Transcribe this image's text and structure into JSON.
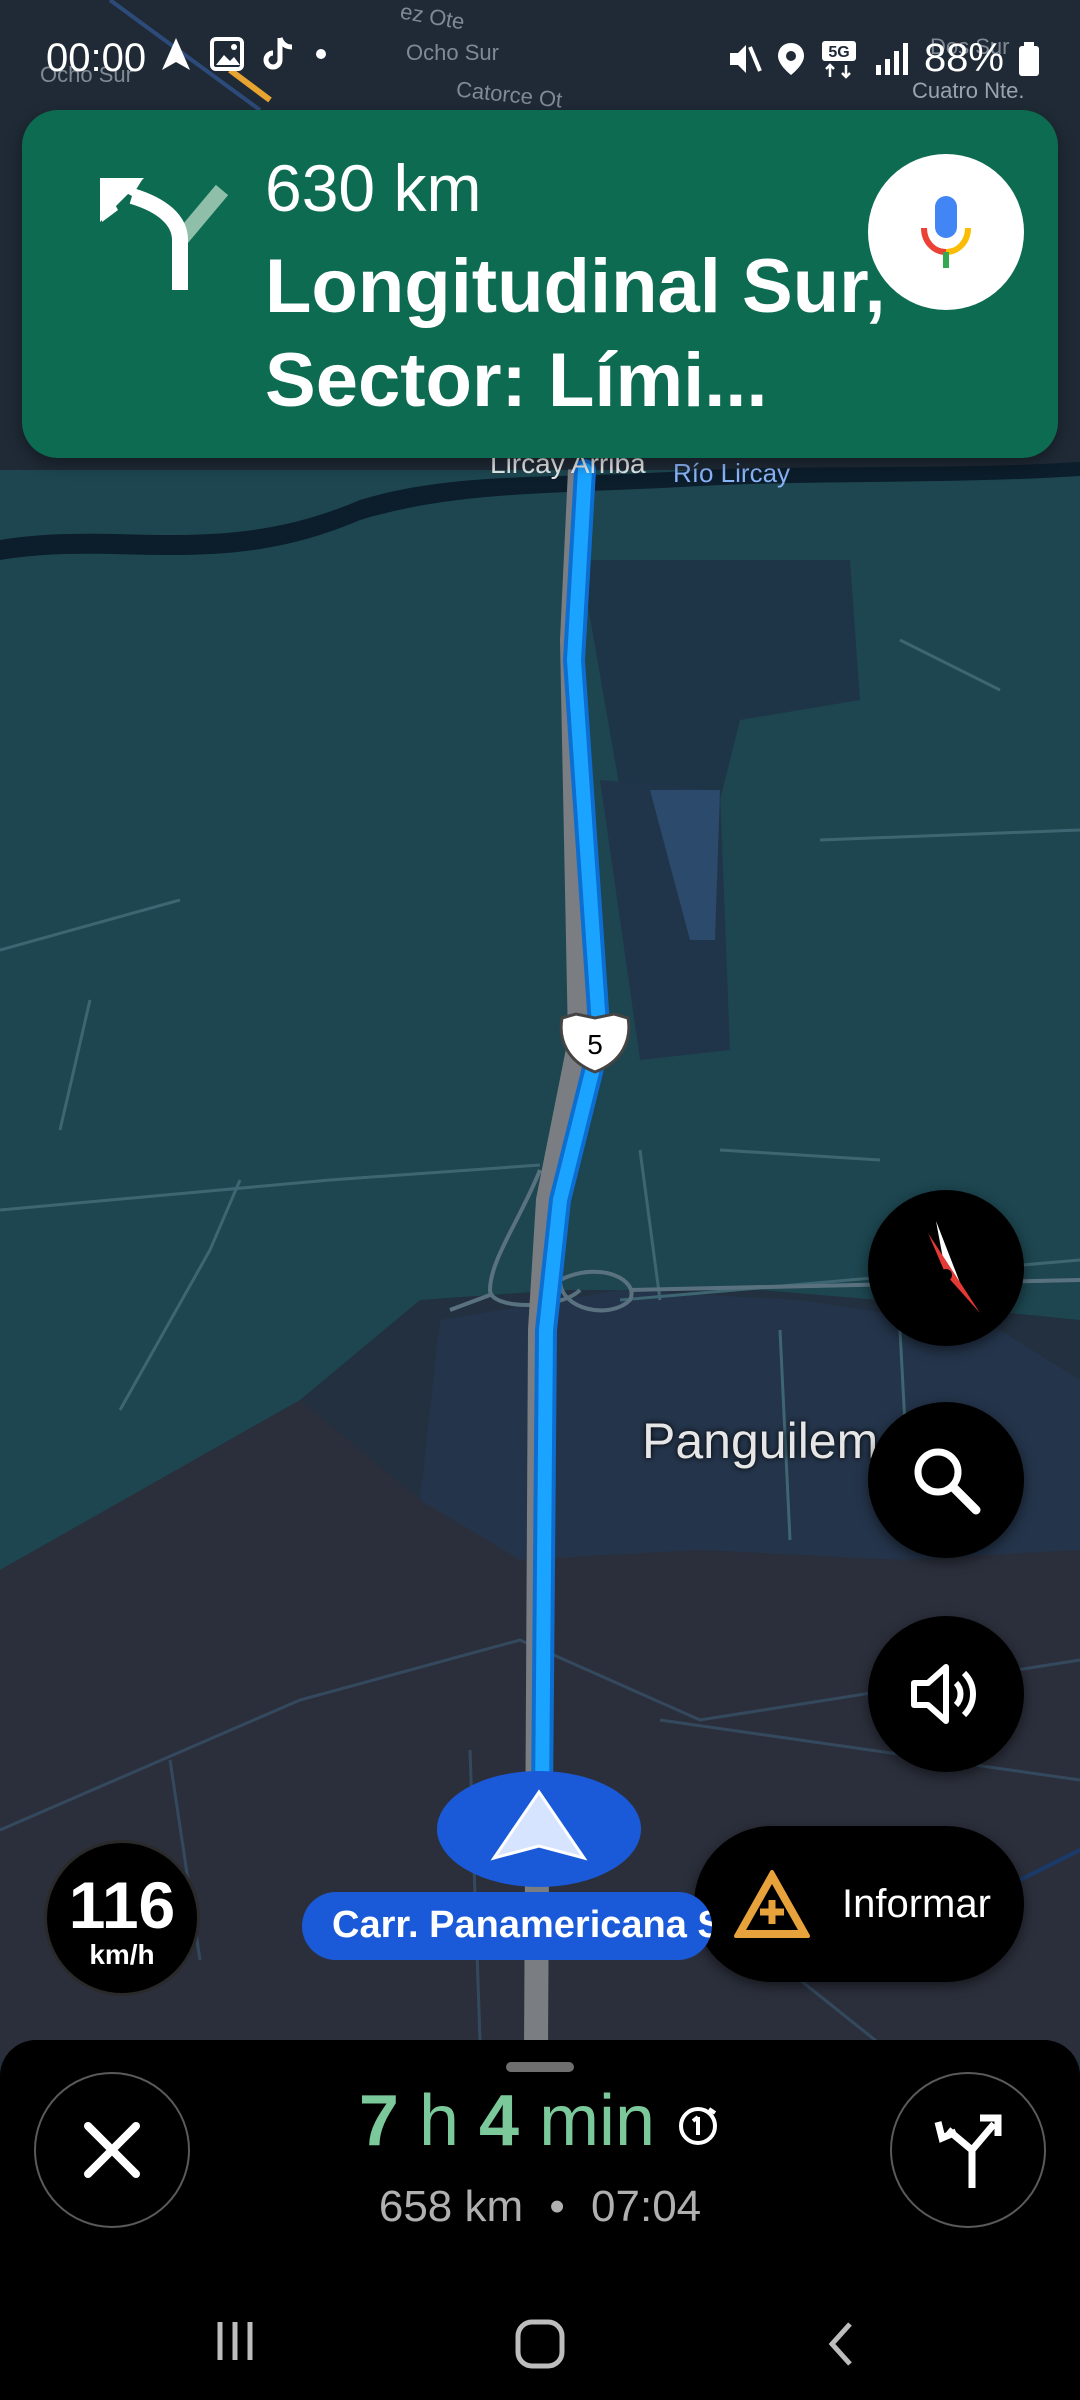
{
  "status_bar": {
    "time": "00:00",
    "battery": "88%",
    "network": "5G"
  },
  "maneuver": {
    "distance": "630 km",
    "street": "Longitudinal Sur, Sector: Lími...",
    "turn_icon": "slight-left-arrow-icon",
    "mic_icon": "microphone-icon"
  },
  "map": {
    "labels": {
      "lircay_arriba": "Lircay Arriba",
      "rio_lircay": "Río Lircay",
      "panguilemo": "Panguilem",
      "ocho_sur_1": "Ocho Sur",
      "ocho_sur_2": "Ocho Sur",
      "catorce": "Catorce Ot",
      "cuatro_nte": "Cuatro Nte.",
      "doce_ote": "ez Ote",
      "dos_sur": "Dos Sur"
    },
    "highway_shield": "5",
    "route_color": "#1aa3ff"
  },
  "controls": {
    "compass_icon": "compass-icon",
    "search_icon": "search-icon",
    "sound_icon": "speaker-icon",
    "report_label": "Informar"
  },
  "speed": {
    "value": "116",
    "unit": "km/h"
  },
  "current_road": "Carr. Panamericana S",
  "trip": {
    "hours": "7",
    "h_label": "h",
    "minutes": "4",
    "min_label": "min",
    "distance": "658 km",
    "separator": "•",
    "arrival": "07:04"
  },
  "colors": {
    "maneuver_bg": "#0d6b51",
    "eta_green": "#7bc99a",
    "route_blue": "#1aa3ff"
  }
}
